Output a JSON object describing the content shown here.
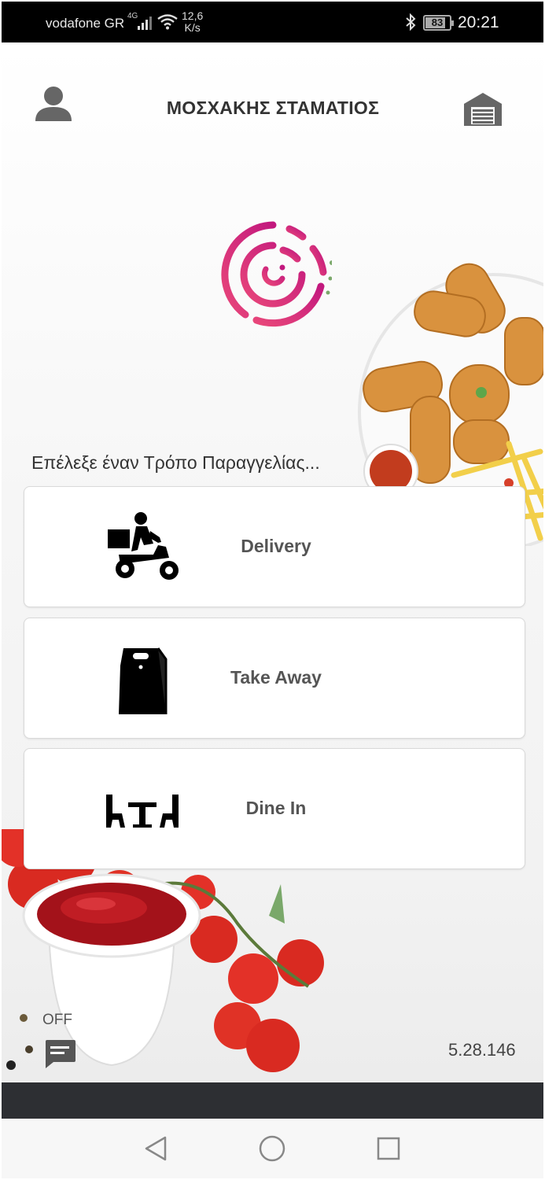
{
  "status_bar": {
    "carrier": "vodafone GR",
    "network": "4G",
    "speed_value": "12,6",
    "speed_unit": "K/s",
    "battery": "83",
    "time": "20:21"
  },
  "header": {
    "user_name": "ΜΟΣΧΑΚΗΣ ΣΤΑΜΑΤΙΟΣ",
    "left_icon": "user-profile-icon",
    "right_icon": "store-icon"
  },
  "main": {
    "prompt": "Επέλεξε έναν Τρόπο Παραγγελίας...",
    "options": [
      {
        "label": "Delivery",
        "icon": "scooter-delivery-icon"
      },
      {
        "label": "Take Away",
        "icon": "takeaway-bag-icon"
      },
      {
        "label": "Dine In",
        "icon": "dine-in-table-icon"
      }
    ]
  },
  "footer": {
    "chat_status": "OFF",
    "chat_icon": "chat-icon",
    "version": "5.28.146"
  },
  "colors": {
    "logo_start": "#e8467a",
    "logo_end": "#c2187e",
    "status_bar_bg": "#000000",
    "bottom_strip": "#2d2f33"
  }
}
